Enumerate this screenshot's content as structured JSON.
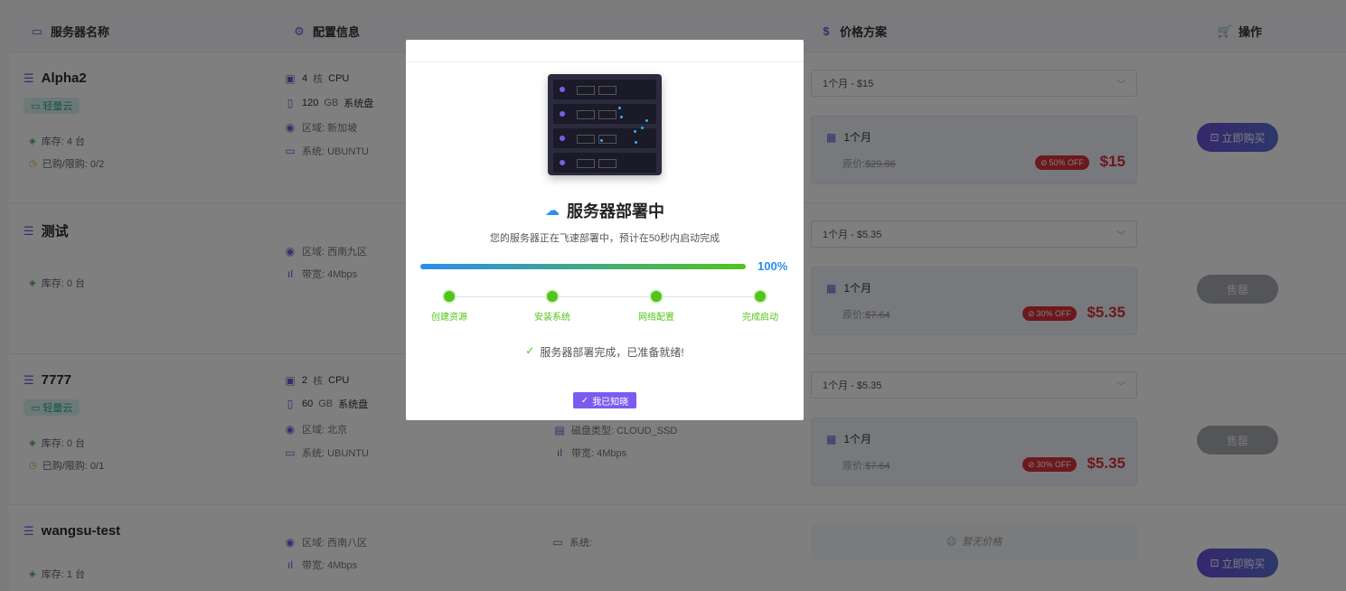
{
  "header": {
    "col_name": "服务器名称",
    "col_config": "配置信息",
    "col_price": "价格方案",
    "col_action": "操作"
  },
  "rows": [
    {
      "name": "Alpha2",
      "tag": "轻量云",
      "stock": "库存: 4 台",
      "limit": "已购/限购: 0/2",
      "cpu_num": "4",
      "cpu_unit": "核",
      "cpu_label": "CPU",
      "disk_num": "120",
      "disk_unit": "GB",
      "disk_label": "系统盘",
      "region": "区域: 新加坡",
      "system": "系统: UBUNTU",
      "plan_select": "1个月 - $15",
      "period": "1个月",
      "orig_label": "原价:",
      "orig_price": "$29.86",
      "discount": "50% OFF",
      "price": "$15",
      "action": "立即购买"
    },
    {
      "name": "测试",
      "stock": "库存: 0 台",
      "region": "区域: 西南九区",
      "bandwidth": "带宽: 4Mbps",
      "plan_select": "1个月 - $5.35",
      "period": "1个月",
      "orig_label": "原价:",
      "orig_price": "$7.64",
      "discount": "30% OFF",
      "price": "$5.35",
      "action": "售罄"
    },
    {
      "name": "7777",
      "tag": "轻量云",
      "stock": "库存: 0 台",
      "limit": "已购/限购: 0/1",
      "cpu_num": "2",
      "cpu_unit": "核",
      "cpu_label": "CPU",
      "disk_num": "60",
      "disk_unit": "GB",
      "disk_label": "系统盘",
      "region": "区域: 北京",
      "system": "系统: UBUNTU",
      "disk_type": "磁盘类型: CLOUD_SSD",
      "bandwidth": "带宽: 4Mbps",
      "plan_select": "1个月 - $5.35",
      "period": "1个月",
      "orig_label": "原价:",
      "orig_price": "$7.64",
      "discount": "30% OFF",
      "price": "$5.35",
      "action": "售罄"
    },
    {
      "name": "wangsu-test",
      "stock": "库存: 1 台",
      "region": "区域: 西南八区",
      "bandwidth": "带宽: 4Mbps",
      "system": "系统:",
      "no_price": "暂无价格",
      "action": "立即购买"
    }
  ],
  "modal": {
    "title": "服务器部署中",
    "subtitle": "您的服务器正在飞速部署中，预计在50秒内启动完成",
    "progress": 1.0,
    "progress_text": "100%",
    "steps": [
      "创建资源",
      "安装系统",
      "网络配置",
      "完成启动"
    ],
    "done_text": "服务器部署完成，已准备就绪!",
    "ok_button": "我已知晓"
  }
}
